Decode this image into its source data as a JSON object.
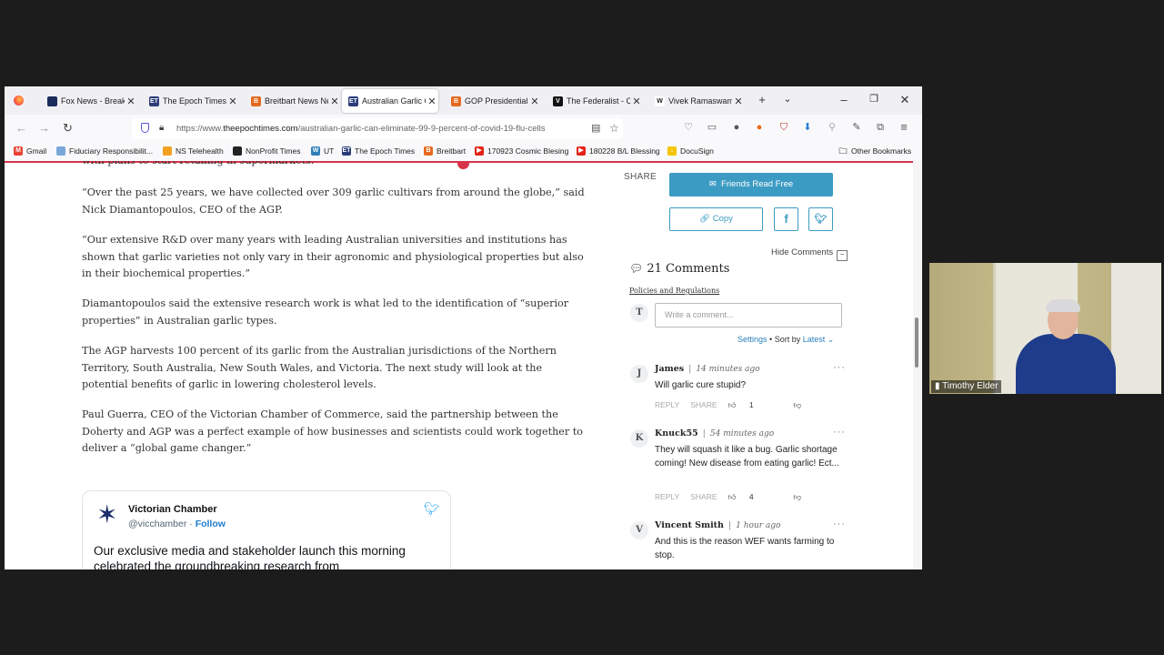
{
  "tabs": [
    {
      "title": "Fox News - Breaki",
      "icon": "fox-news-icon",
      "color": "#1a2c5b",
      "glyph": "",
      "active": false
    },
    {
      "title": "The Epoch Times",
      "icon": "epoch-times-icon",
      "color": "#2b3d7a",
      "glyph": "ET",
      "active": false
    },
    {
      "title": "Breitbart News Ne",
      "icon": "breitbart-icon",
      "color": "#e56a1f",
      "glyph": "B",
      "active": false
    },
    {
      "title": "Australian Garlic C",
      "icon": "epoch-times-icon",
      "color": "#2b3d7a",
      "glyph": "ET",
      "active": true
    },
    {
      "title": "GOP Presidential C",
      "icon": "breitbart-icon",
      "color": "#e56a1f",
      "glyph": "B",
      "active": false
    },
    {
      "title": "The Federalist - C",
      "icon": "federalist-icon",
      "color": "#111111",
      "glyph": "V",
      "active": false
    },
    {
      "title": "Vivek Ramaswamy",
      "icon": "wikipedia-icon",
      "color": "#ffffff",
      "glyph": "W",
      "active": false
    }
  ],
  "url": {
    "prefix": "https://www.",
    "domain": "theepochtimes.com",
    "path": "/australian-garlic-can-eliminate-99-9-percent-of-covid-19-flu-cells"
  },
  "bookmarks": [
    {
      "label": "Gmail",
      "color": "#ea4335",
      "glyph": "M"
    },
    {
      "label": "Fiduciary Responsibilit...",
      "color": "#7aa7d9",
      "glyph": ""
    },
    {
      "label": "NS Telehealth",
      "color": "#f2a01f",
      "glyph": ""
    },
    {
      "label": "NonProfit Times",
      "color": "#222222",
      "glyph": ""
    },
    {
      "label": "UT",
      "color": "#2f7fb8",
      "glyph": "W"
    },
    {
      "label": "The Epoch Times",
      "color": "#2b3d7a",
      "glyph": "ET"
    },
    {
      "label": "Breitbart",
      "color": "#e56a1f",
      "glyph": "B"
    },
    {
      "label": "170923 Cosmic Blesing",
      "color": "#e62117",
      "glyph": "▶"
    },
    {
      "label": "180228 B/L Blessing",
      "color": "#e62117",
      "glyph": "▶"
    },
    {
      "label": "DocuSign",
      "color": "#f4c400",
      "glyph": "↓"
    }
  ],
  "other_bookmarks": "Other Bookmarks",
  "article": {
    "cut_line": "with plans to start retailing in supermarkets.",
    "paragraphs": [
      "“Over the past 25 years, we have collected over 309 garlic cultivars from around the globe,” said Nick Diamantopoulos, CEO of the AGP.",
      "“Our extensive R&D over many years with leading Australian universities and institutions has shown that garlic varieties not only vary in their agronomic and physiological properties but also in their biochemical properties.”",
      "Diamantopoulos said the extensive research work is what led to the identification of “superior properties” in Australian garlic types.",
      "The AGP harvests 100 percent of its garlic from the Australian jurisdictions of the Northern Territory, South Australia, New South Wales, and Victoria. The next study will look at the potential benefits of garlic in lowering cholesterol levels.",
      "Paul Guerra, CEO of the Victorian Chamber of Commerce, said the partnership between the Doherty and AGP was a perfect example of how businesses and scientists could work together to deliver a “global game changer.”"
    ]
  },
  "tweet": {
    "name": "Victorian Chamber",
    "handle": "@vicchamber",
    "dot": "·",
    "follow": "Follow",
    "text": "Our exclusive media and stakeholder launch this morning celebrated the groundbreaking research from"
  },
  "sidebar": {
    "share": "SHARE",
    "friends_read_free": "Friends Read Free",
    "copy": "Copy",
    "hide_comments": "Hide Comments",
    "hide_glyph": "−",
    "comments_title": "21 Comments",
    "policies": "Policies and Regulations",
    "user_initial": "T",
    "write_placeholder": "Write a comment...",
    "settings": "Settings",
    "sort_by": "• Sort by",
    "latest": "Latest"
  },
  "comments": [
    {
      "initial": "J",
      "author": "James",
      "time": "14 minutes ago",
      "text": "Will garlic cure stupid?",
      "likes": "1"
    },
    {
      "initial": "K",
      "author": "Knuck55",
      "time": "54 minutes ago",
      "text": "They will squash it like a bug. Garlic shortage coming! New disease from eating garlic! Ect...",
      "likes": "4"
    },
    {
      "initial": "V",
      "author": "Vincent Smith",
      "time": "1 hour ago",
      "text": "And this is the reason WEF wants farming to stop.",
      "likes": ""
    }
  ],
  "comment_actions": {
    "reply": "REPLY",
    "share": "SHARE",
    "dots": "···"
  },
  "webcam": {
    "name": "Timothy Elder"
  }
}
